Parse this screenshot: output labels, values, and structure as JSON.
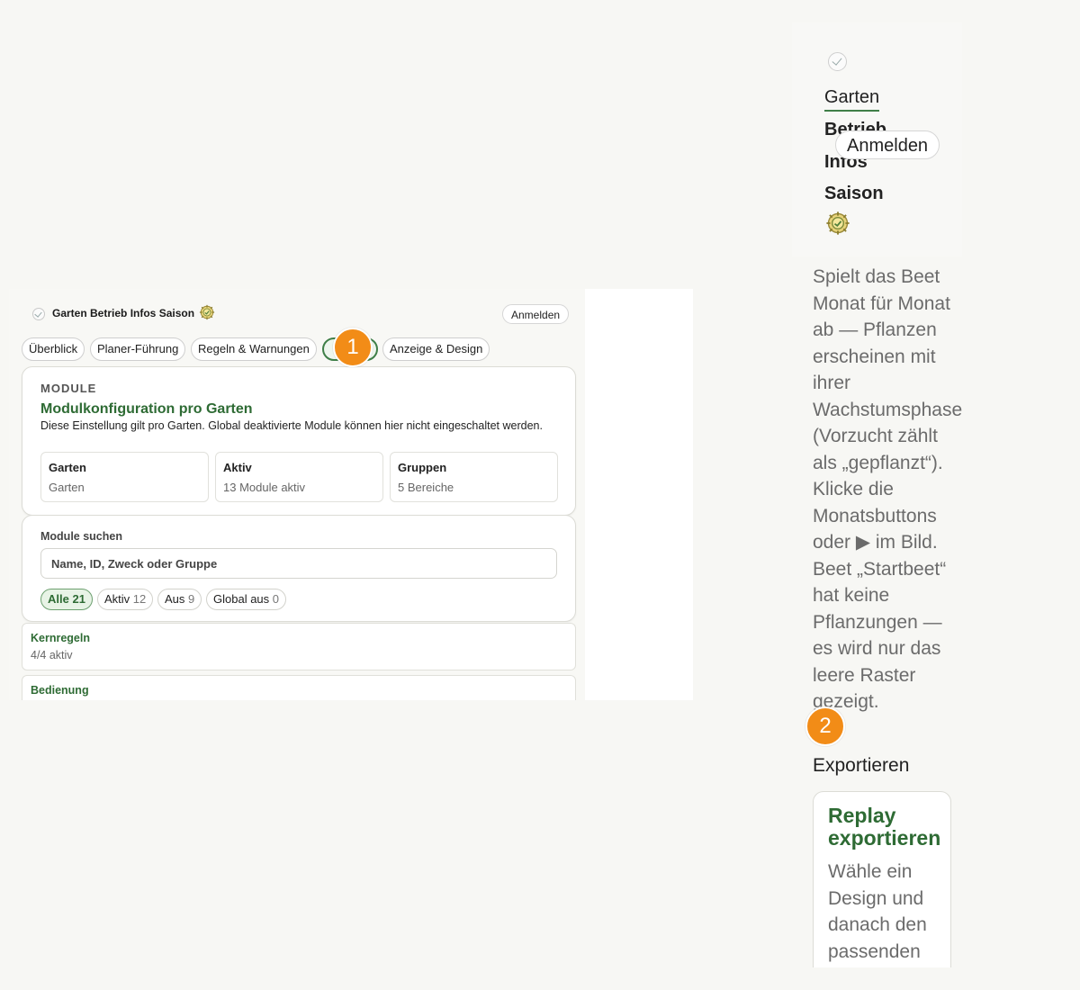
{
  "left": {
    "brand": "Garten Betrieb Infos Saison",
    "login_label": "Anmelden",
    "tabs": [
      {
        "label": "Überblick"
      },
      {
        "label": "Planer-Führung"
      },
      {
        "label": "Regeln & Warnungen"
      },
      {
        "label": ""
      },
      {
        "label": "Anzeige & Design"
      }
    ],
    "module_card": {
      "overline": "MODULE",
      "title": "Modulkonfiguration pro Garten",
      "description": "Diese Einstellung gilt pro Garten. Global deaktivierte Module können hier nicht eingeschaltet werden.",
      "stats": [
        {
          "key": "Garten",
          "value": "Garten"
        },
        {
          "key": "Aktiv",
          "value": "13 Module aktiv"
        },
        {
          "key": "Gruppen",
          "value": "5 Bereiche"
        }
      ]
    },
    "search": {
      "label": "Module suchen",
      "placeholder": "Name, ID, Zweck oder Gruppe",
      "filters": [
        {
          "label": "Alle",
          "count": "21"
        },
        {
          "label": "Aktiv",
          "count": "12"
        },
        {
          "label": "Aus",
          "count": "9"
        },
        {
          "label": "Global aus",
          "count": "0"
        }
      ]
    },
    "groups": [
      {
        "title": "Kernregeln",
        "status": "4/4 aktiv"
      },
      {
        "title": "Bedienung",
        "status": ""
      }
    ]
  },
  "badges": {
    "one": "1",
    "two": "2"
  },
  "mobile": {
    "nav": {
      "garten": "Garten",
      "betrieb": "Betrieb",
      "infos": "Infos",
      "saison": "Saison",
      "login_label": "Anmelden"
    },
    "help_text": "Spielt das Beet Monat für Monat ab — Pflanzen erscheinen mit ihrer Wachstumsphase (Vorzucht zählt als „gepflanzt“). Klicke die Monatsbuttons oder ▶ im Bild. Beet „Startbeet“ hat keine Pflanzungen — es wird nur das leere Raster gezeigt.",
    "export_label": "Exportieren",
    "export_card": {
      "title": "Replay exportieren",
      "description": "Wähle ein Design und danach den passenden"
    }
  },
  "colors": {
    "accent_green": "#2e6b34",
    "badge_orange": "#f28c17"
  },
  "icons": [
    "brand-logo-icon",
    "sun-gear-icon"
  ]
}
